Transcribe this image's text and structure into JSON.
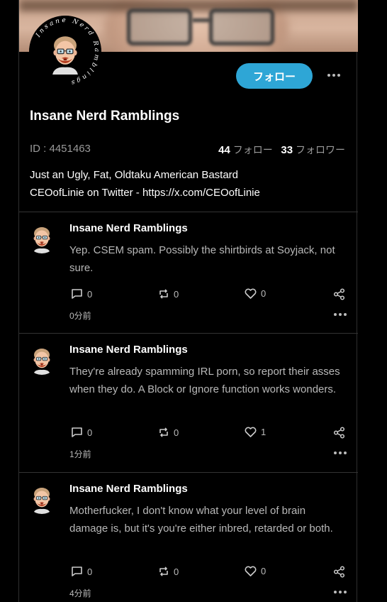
{
  "profile": {
    "name": "Insane Nerd Ramblings",
    "id_text": "ID : 4451463",
    "following_count": "44",
    "following_label": "フォロー",
    "followers_count": "33",
    "followers_label": "フォロワー",
    "follow_button": "フォロー",
    "bio_line1": "Just an Ugly, Fat, Oldtaku American Bastard",
    "bio_line2": "CEOofLinie on Twitter - https://x.com/CEOofLinie",
    "avatar_ring_text": "Insane Nerd Ramblings"
  },
  "posts": [
    {
      "author": "Insane Nerd Ramblings",
      "text": "Yep. CSEM spam. Possibly the shirtbirds at Soyjack, not sure.",
      "replies": "0",
      "reposts": "0",
      "likes": "0",
      "time": "0分前"
    },
    {
      "author": "Insane Nerd Ramblings",
      "text": "They're already spamming IRL porn, so report their asses when they do. A Block or Ignore function works wonders.",
      "replies": "0",
      "reposts": "0",
      "likes": "1",
      "time": "1分前"
    },
    {
      "author": "Insane Nerd Ramblings",
      "text": "Motherfucker, I don't know what your level of brain damage is, but it's you're either inbred, retarded or both.",
      "replies": "0",
      "reposts": "0",
      "likes": "0",
      "time": "4分前"
    }
  ],
  "colors": {
    "accent": "#2ea6d6",
    "background": "#000000",
    "muted_text": "#9a9a9a"
  }
}
